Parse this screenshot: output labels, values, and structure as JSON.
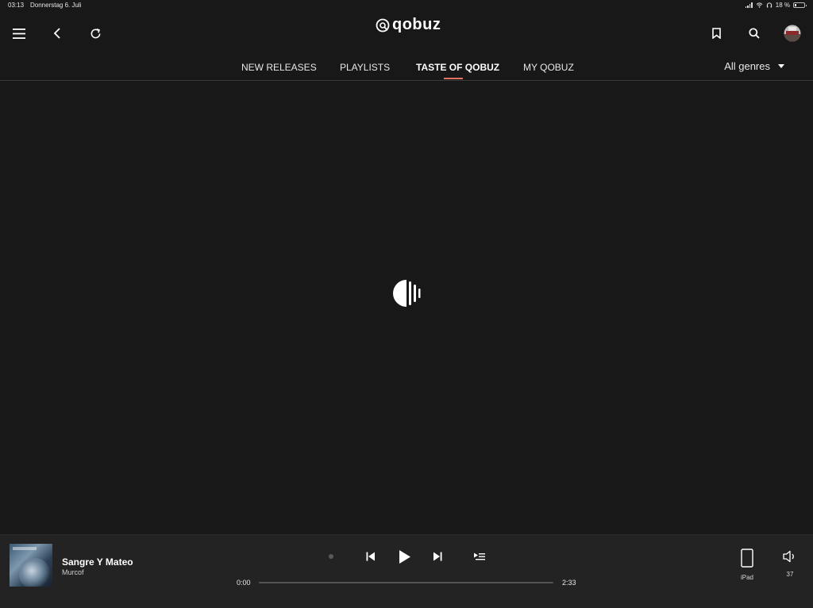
{
  "status_bar": {
    "time": "03:13",
    "date": "Donnerstag 6. Juli",
    "battery_text": "18 %",
    "battery_level": 0.18
  },
  "header": {
    "logo_text": "qobuz",
    "icons": {
      "menu": "menu-icon",
      "back": "back-icon",
      "refresh": "refresh-icon",
      "bookmark": "bookmark-icon",
      "search": "search-icon",
      "avatar": "avatar"
    }
  },
  "nav": {
    "tabs": [
      {
        "label": "NEW RELEASES",
        "active": false
      },
      {
        "label": "PLAYLISTS",
        "active": false
      },
      {
        "label": "TASTE OF QOBUZ",
        "active": true
      },
      {
        "label": "MY QOBUZ",
        "active": false
      }
    ],
    "genre_filter": "All genres",
    "accent_color": "#e07060"
  },
  "player": {
    "track_title": "Sangre Y Mateo",
    "track_artist": "Murcof",
    "current_time": "0:00",
    "total_time": "2:33",
    "progress": 0.0,
    "device_label": "iPad",
    "volume_value": "37",
    "progress_color": "#8a7fd6"
  },
  "colors": {
    "background": "#181818",
    "player_background": "#232323",
    "text": "#ffffff"
  }
}
